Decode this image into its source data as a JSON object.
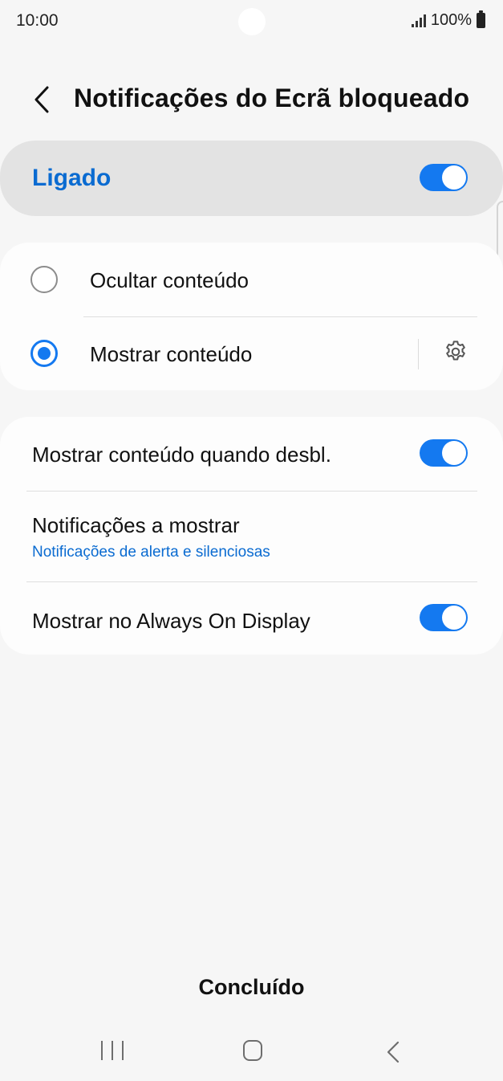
{
  "status_bar": {
    "time": "10:00",
    "battery_text": "100%",
    "icons": [
      "signal-icon",
      "battery-icon"
    ]
  },
  "header": {
    "back_icon": "chevron-left-icon",
    "title": "Notificações do Ecrã bloqueado"
  },
  "master_switch": {
    "label": "Ligado",
    "state": true
  },
  "content_options": {
    "selected": "Mostrar conteúdo",
    "options": [
      {
        "label": "Ocultar conteúdo",
        "checked": false
      },
      {
        "label": "Mostrar conteúdo",
        "checked": true,
        "settings_icon": "gear-icon"
      }
    ]
  },
  "settings": {
    "show_when_unlocked": {
      "label": "Mostrar conteúdo quando desbl.",
      "state": true
    },
    "notifications_to_show": {
      "label": "Notificações a mostrar",
      "value": "Notificações de alerta e silenciosas"
    },
    "always_on_display": {
      "label": "Mostrar no Always On Display",
      "state": true
    }
  },
  "footer": {
    "done_label": "Concluído"
  },
  "nav_bar": {
    "icons": [
      "recent-apps-icon",
      "home-icon",
      "back-icon"
    ]
  },
  "colors": {
    "accent": "#1479f0",
    "accent_text": "#0a6bd1",
    "background": "#f6f6f6",
    "card": "#fdfdfd",
    "master_bg": "#e3e3e3"
  }
}
